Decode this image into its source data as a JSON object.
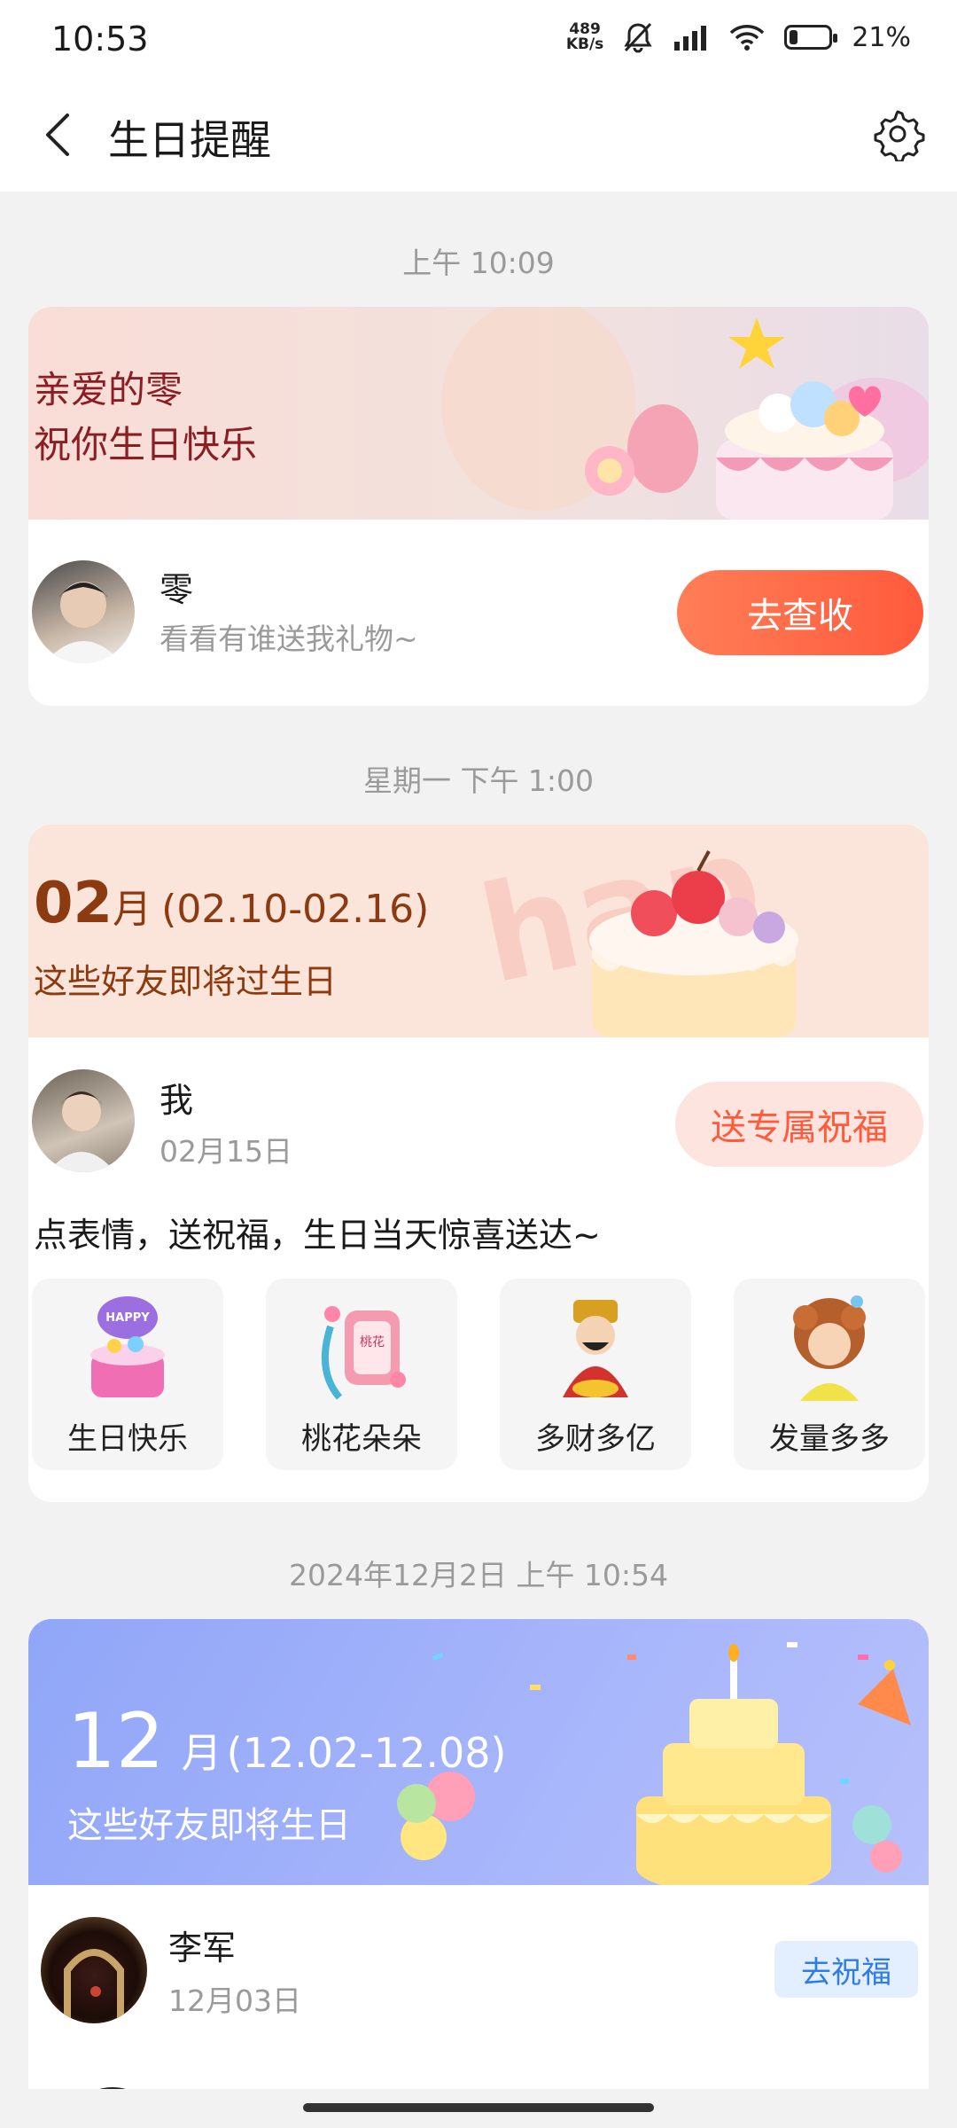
{
  "status": {
    "time": "10:53",
    "net_speed_top": "489",
    "net_speed_bottom": "KB/s",
    "battery": "21%",
    "battery_level": 0.21
  },
  "header": {
    "title": "生日提醒"
  },
  "groups": [
    {
      "timestamp": "上午 10:09",
      "banner_line1": "亲爱的零",
      "banner_line2": "祝你生日快乐",
      "name": "零",
      "subtitle": "看看有谁送我礼物~",
      "button": "去查收"
    },
    {
      "timestamp": "星期一 下午 1:00",
      "banner_month": "02",
      "banner_month_unit": "月",
      "banner_range": "(02.10-02.16)",
      "banner_line2": "这些好友即将过生日",
      "name": "我",
      "date": "02月15日",
      "button": "送专属祝福",
      "prompt": "点表情，送祝福，生日当天惊喜送达~",
      "stickers": [
        {
          "label": "生日快乐",
          "icon": "birthday-cake-sticker"
        },
        {
          "label": "桃花朵朵",
          "icon": "peach-blossom-charm-sticker"
        },
        {
          "label": "多财多亿",
          "icon": "god-of-wealth-sticker"
        },
        {
          "label": "发量多多",
          "icon": "curly-hair-kid-sticker"
        }
      ]
    },
    {
      "timestamp": "2024年12月2日 上午 10:54",
      "banner_month": "12",
      "banner_month_unit": "月",
      "banner_range": "(12.02-12.08)",
      "banner_line2": "这些好友即将生日",
      "name": "李军",
      "date": "12月03日",
      "button": "去祝福"
    }
  ]
}
